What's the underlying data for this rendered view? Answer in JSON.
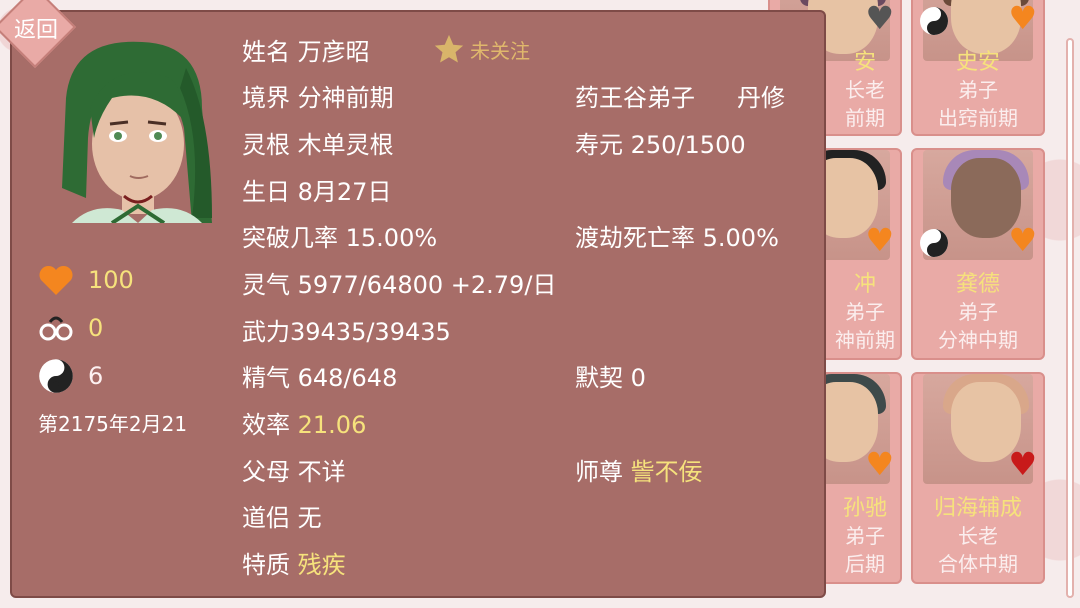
{
  "panel": {
    "back_label": "返回",
    "follow_label": "未关注",
    "name_label": "姓名",
    "name_value": "万彦昭",
    "realm_label": "境界",
    "realm_value": "分神前期",
    "sect": "药王谷弟子",
    "profession": "丹修",
    "root_label": "灵根",
    "root_value": "木单灵根",
    "lifespan_label": "寿元",
    "lifespan_value": "250/1500",
    "birthday_label": "生日",
    "birthday_value": "8月27日",
    "breakthrough_label": "突破几率",
    "breakthrough_value": "15.00%",
    "tribulation_label": "渡劫死亡率",
    "tribulation_value": "5.00%",
    "qi_label": "灵气",
    "qi_value": "5977/64800 +2.79/日",
    "force_label": "武力",
    "force_value": "39435/39435",
    "essence_label": "精气",
    "essence_value": "648/648",
    "rapport_label": "默契",
    "rapport_value": "0",
    "efficiency_label": "效率",
    "efficiency_value": "21.06",
    "parents_label": "父母",
    "parents_value": "不详",
    "master_label": "师尊",
    "master_value": "訾不佞",
    "partner_label": "道侣",
    "partner_value": "无",
    "trait_label": "特质",
    "trait_value": "残疾",
    "stats": {
      "favor": "100",
      "shackle": "0",
      "taiji": "6"
    },
    "date": "第2175年2月21"
  },
  "cards": [
    {
      "name": "史安",
      "line1": "弟子",
      "line2": "出窍前期",
      "heart": "#f4861f",
      "hair": "#6b4a3a"
    },
    {
      "name": "龚德",
      "line1": "弟子",
      "line2": "分神中期",
      "heart": "#f4861f",
      "hair": "#a888b8"
    },
    {
      "name": "归海辅成",
      "line1": "长老",
      "line2": "合体中期",
      "heart": "#c81a1a",
      "hair": "#d9a78a"
    },
    {
      "name": "安",
      "line1": "长老",
      "line2": "前期",
      "heart": "#555555",
      "hair": "#6a4a60"
    },
    {
      "name": "冲",
      "line1": "弟子",
      "line2": "神前期",
      "heart": "#f4861f",
      "hair": "#222222"
    },
    {
      "name": "孙驰",
      "line1": "弟子",
      "line2": "后期",
      "heart": "#f4861f",
      "hair": "#3e4a4a"
    }
  ],
  "colors": {
    "panel": "#a76d68",
    "gold": "#f6e27c",
    "card": "#e9aaa6"
  }
}
